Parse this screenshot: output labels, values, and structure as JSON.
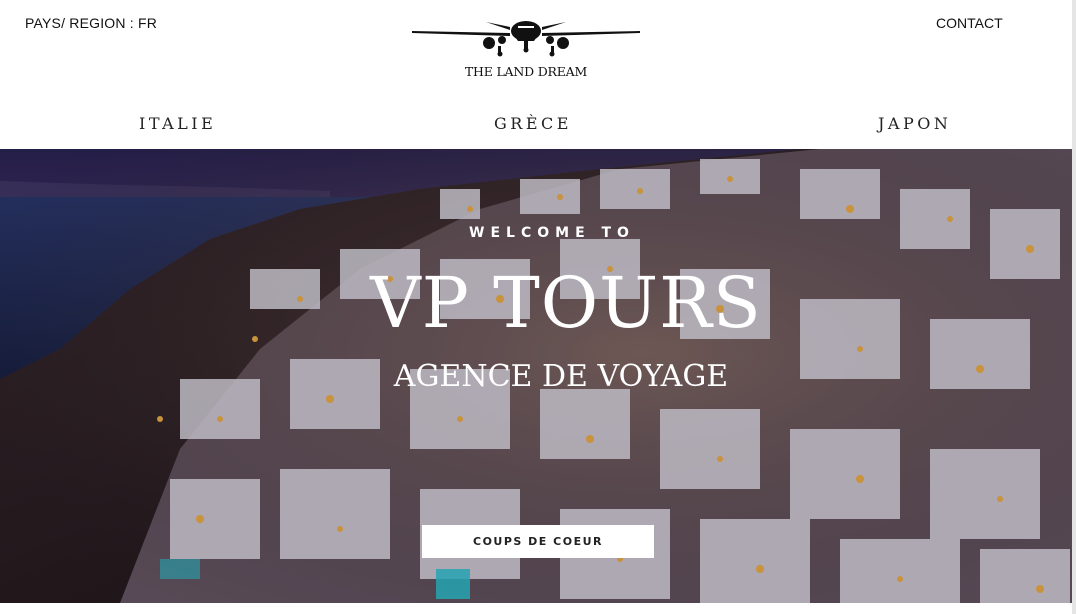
{
  "header": {
    "region_label": "PAYS/ REGION : FR",
    "contact_label": "CONTACT",
    "logo_text": "THE LAND DREAM"
  },
  "nav": {
    "items": [
      {
        "label": "ITALIE"
      },
      {
        "label": "GRÈCE"
      },
      {
        "label": "JAPON"
      }
    ]
  },
  "hero": {
    "welcome": "WELCOME TO",
    "title": "VP TOURS",
    "subtitle": "AGENCE DE VOYAGE",
    "cta_label": "COUPS DE COEUR"
  },
  "colors": {
    "sky_top": "#3b3468",
    "sea": "#1d2a5a",
    "lights": "#f6b24a"
  },
  "icons": {
    "logo": "airplane-icon"
  }
}
